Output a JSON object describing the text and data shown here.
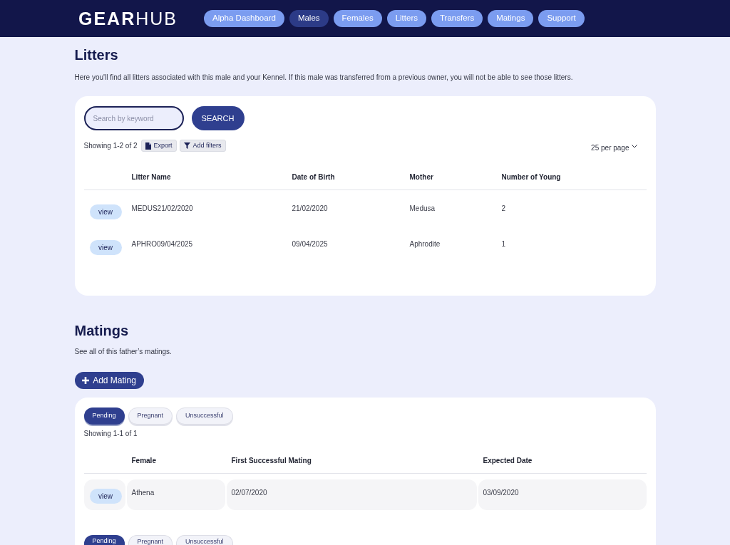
{
  "header": {
    "logo": "**GEAR**HUB",
    "nav": [
      {
        "label": "Alpha Dashboard",
        "selected": false
      },
      {
        "label": "Males",
        "selected": true
      },
      {
        "label": "Females",
        "selected": false
      },
      {
        "label": "Litters",
        "selected": false
      },
      {
        "label": "Transfers",
        "selected": false
      },
      {
        "label": "Matings",
        "selected": false
      },
      {
        "label": "Support",
        "selected": false
      }
    ]
  },
  "litters": {
    "title": "Litters",
    "description": "Here you'll find all litters associated with this male and your Kennel. If this male was transferred from a previous owner, you will not be able to see those litters.",
    "search": {
      "placeholder": "Search by keyword",
      "button": "SEARCH"
    },
    "summary": "Showing 1-2 of 2",
    "tools": [
      {
        "kind": "export",
        "label": "Export"
      },
      {
        "kind": "filter",
        "label": "Add filters"
      }
    ],
    "per_page": "25 per page",
    "table": {
      "columns": [
        "Litter Name",
        "Date of Birth",
        "Mother",
        "Number of Young"
      ],
      "rows": [
        {
          "action": "view",
          "cells": [
            "MEDUS21/02/2020",
            "21/02/2020",
            "Medusa",
            "2"
          ]
        },
        {
          "action": "view",
          "cells": [
            "APHRO09/04/2025",
            "09/04/2025",
            "Aphrodite",
            "1"
          ]
        }
      ]
    }
  },
  "matings": {
    "title": "Matings",
    "description": "See all of this father’s matings.",
    "add_button": "Add Mating",
    "panels": [
      {
        "tabs": [
          {
            "label": "Pending",
            "selected": true
          },
          {
            "label": "Pregnant",
            "selected": false
          },
          {
            "label": "Unsuccessful",
            "selected": false
          }
        ],
        "summary": "Showing 1-1 of 1",
        "table": {
          "columns": [
            "Female",
            "First Successful Mating",
            "Expected Date"
          ],
          "rows": [
            {
              "action": "view",
              "cells": [
                "Athena",
                "02/07/2020",
                "03/09/2020"
              ]
            }
          ]
        }
      },
      {
        "tabs": [
          {
            "label": "Pending",
            "selected": true
          },
          {
            "label": "Pregnant",
            "selected": false
          },
          {
            "label": "Unsuccessful",
            "selected": false
          }
        ]
      }
    ]
  }
}
